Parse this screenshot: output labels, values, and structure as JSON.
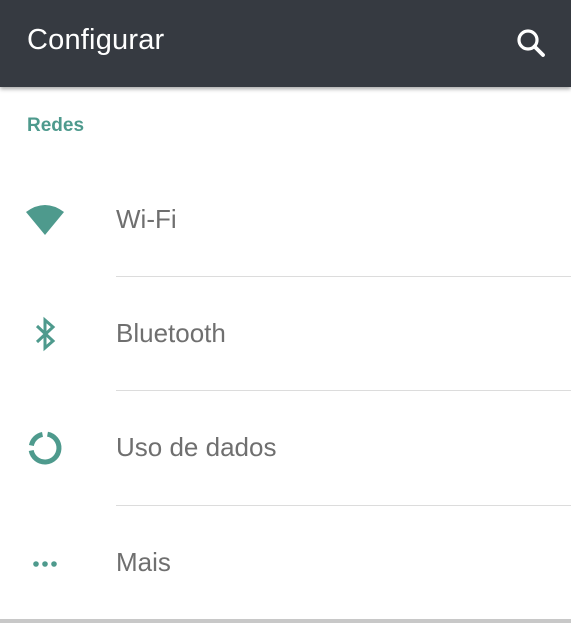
{
  "app_bar": {
    "title": "Configurar",
    "search_icon": "search-icon",
    "background": "#363a41"
  },
  "sections": [
    {
      "header": "Redes",
      "items": [
        {
          "label": "Wi-Fi",
          "icon": "wifi-icon"
        },
        {
          "label": "Bluetooth",
          "icon": "bluetooth-icon"
        },
        {
          "label": "Uso de dados",
          "icon": "data-usage-icon"
        },
        {
          "label": "Mais",
          "icon": "more-icon"
        }
      ]
    }
  ],
  "colors": {
    "accent": "#4e9a8d",
    "label_text": "#6f6f6f",
    "divider": "#dcdcdc"
  }
}
